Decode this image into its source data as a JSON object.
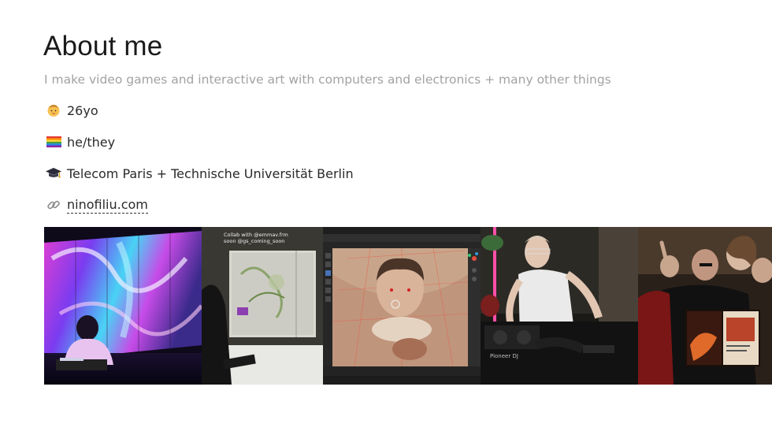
{
  "about": {
    "title": "About me",
    "subtitle": "I make video games and interactive art with computers and electronics + many other things"
  },
  "facts": [
    {
      "icon": "baby-face-icon",
      "text": "26yo"
    },
    {
      "icon": "rainbow-flag-icon",
      "text": "he/they"
    },
    {
      "icon": "graduation-cap-icon",
      "text": "Telecom Paris + Technische Universität Berlin"
    },
    {
      "icon": "link-icon",
      "text": "ninofiliu.com"
    }
  ],
  "gallery": {
    "photos": [
      {
        "name": "photo-projection-performance"
      },
      {
        "name": "photo-electronics-installation",
        "caption_line1": "Collab with @emmav.frm",
        "caption_line2": "soon @gs_coming_soon"
      },
      {
        "name": "photo-3d-editor-face"
      },
      {
        "name": "photo-dj-set",
        "label": "Pioneer DJ"
      },
      {
        "name": "photo-magazine-group"
      }
    ]
  }
}
